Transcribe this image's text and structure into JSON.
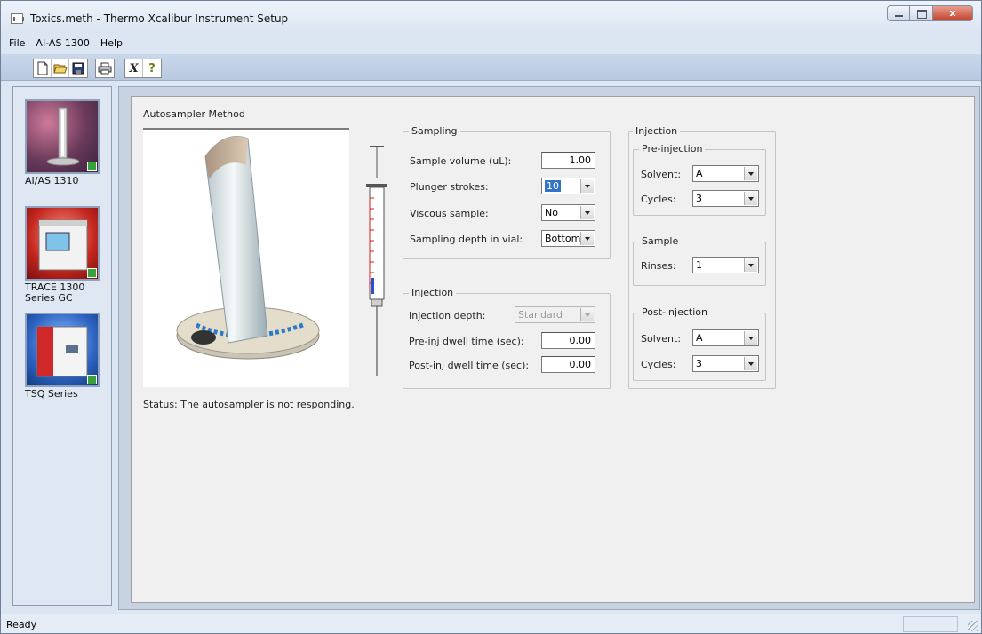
{
  "window": {
    "title": "Toxics.meth - Thermo Xcalibur Instrument Setup",
    "close_glyph": "x"
  },
  "menu": [
    "File",
    "AI-AS 1300",
    "Help"
  ],
  "toolbar": {
    "icons": [
      "new-file-icon",
      "open-folder-icon",
      "save-icon",
      "print-icon",
      "cut-icon",
      "help-icon"
    ],
    "cut_glyph": "X",
    "help_glyph": "?"
  },
  "sidebar": {
    "instruments": [
      {
        "label": "AI/AS 1310",
        "icon": "autosampler-thumbnail-icon"
      },
      {
        "label": "TRACE 1300 Series GC",
        "icon": "gc-thumbnail-icon"
      },
      {
        "label": "TSQ Series",
        "icon": "ms-thumbnail-icon"
      }
    ]
  },
  "main": {
    "section_title": "Autosampler Method",
    "status": "Status: The autosampler is not responding."
  },
  "sampling": {
    "legend": "Sampling",
    "sample_volume_label": "Sample volume (uL):",
    "sample_volume_value": "1.00",
    "plunger_strokes_label": "Plunger strokes:",
    "plunger_strokes_value": "10",
    "viscous_sample_label": "Viscous sample:",
    "viscous_sample_value": "No",
    "sampling_depth_label": "Sampling depth in vial:",
    "sampling_depth_value": "Bottom"
  },
  "injection_left": {
    "legend": "Injection",
    "injection_depth_label": "Injection depth:",
    "injection_depth_value": "Standard",
    "pre_dwell_label": "Pre-inj dwell time (sec):",
    "pre_dwell_value": "0.00",
    "post_dwell_label": "Post-inj dwell time (sec):",
    "post_dwell_value": "0.00"
  },
  "injection_right": {
    "legend": "Injection",
    "pre_injection": {
      "legend": "Pre-injection",
      "solvent_label": "Solvent:",
      "solvent_value": "A",
      "cycles_label": "Cycles:",
      "cycles_value": "3"
    },
    "sample": {
      "legend": "Sample",
      "rinses_label": "Rinses:",
      "rinses_value": "1"
    },
    "post_injection": {
      "legend": "Post-injection",
      "solvent_label": "Solvent:",
      "solvent_value": "A",
      "cycles_label": "Cycles:",
      "cycles_value": "3"
    }
  },
  "statusbar": {
    "text": "Ready"
  },
  "colors": {
    "accent": "#3173c8",
    "check": "#3aa03a",
    "syringe_red": "#cc2222",
    "syringe_blue": "#2255cc"
  }
}
